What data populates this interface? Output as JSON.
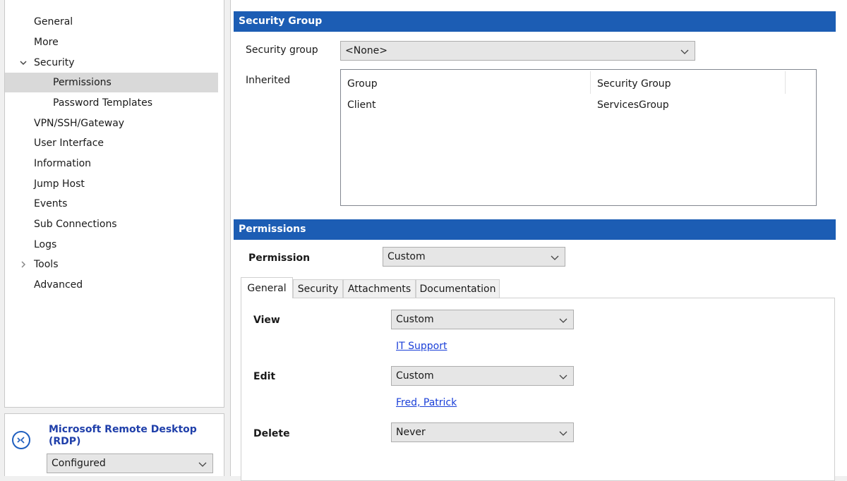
{
  "sidebar": {
    "items": [
      {
        "label": "General"
      },
      {
        "label": "More"
      },
      {
        "label": "Security"
      },
      {
        "label": "Permissions"
      },
      {
        "label": "Password Templates"
      },
      {
        "label": "VPN/SSH/Gateway"
      },
      {
        "label": "User Interface"
      },
      {
        "label": "Information"
      },
      {
        "label": "Jump Host"
      },
      {
        "label": "Events"
      },
      {
        "label": "Sub Connections"
      },
      {
        "label": "Logs"
      },
      {
        "label": "Tools"
      },
      {
        "label": "Advanced"
      }
    ],
    "selected": "Permissions",
    "expanded": "Security",
    "collapsed": "Tools"
  },
  "connection": {
    "name": "Microsoft Remote Desktop (RDP)",
    "status": "Configured",
    "icon": "remote-desktop-icon"
  },
  "security_group_section": {
    "title": "Security Group",
    "security_group_label": "Security group",
    "security_group_value": "<None>",
    "inherited_label": "Inherited",
    "inherited_table": {
      "columns": [
        "Group",
        "Security Group"
      ],
      "rows": [
        [
          "Client",
          "ServicesGroup"
        ]
      ]
    }
  },
  "permissions_section": {
    "title": "Permissions",
    "permission_label": "Permission",
    "permission_value": "Custom",
    "tabs": [
      "General",
      "Security",
      "Attachments",
      "Documentation"
    ],
    "active_tab": "General",
    "view_label": "View",
    "view_value": "Custom",
    "view_link": "IT Support",
    "edit_label": "Edit",
    "edit_value": "Custom",
    "edit_link": "Fred, Patrick",
    "delete_label": "Delete",
    "delete_value": "Never"
  },
  "colors": {
    "section_header": "#1c5db4",
    "link": "#1a3fd8",
    "selected_row": "#d9d9d9"
  }
}
